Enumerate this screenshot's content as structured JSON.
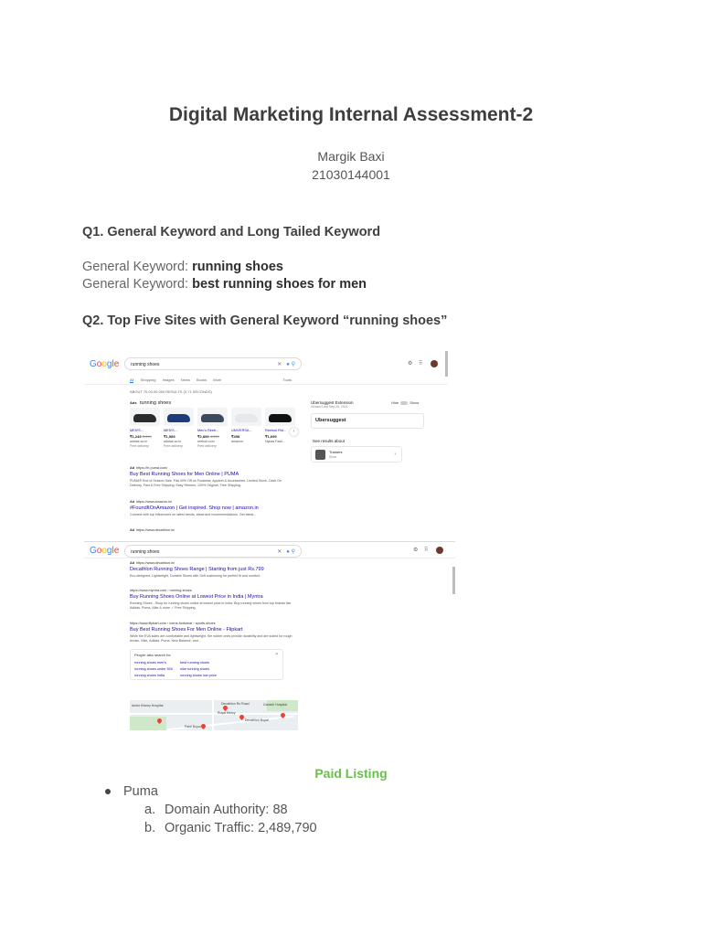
{
  "title": "Digital Marketing Internal Assessment-2",
  "author": {
    "name": "Margik Baxi",
    "id": "21030144001"
  },
  "q1": {
    "heading": "Q1. General Keyword and Long Tailed Keyword",
    "general_label": "General Keyword:",
    "general_value": "running shoes",
    "long_label": "General Keyword:",
    "long_value": "best running shoes for men"
  },
  "q2": {
    "heading": "Q2. Top Five Sites with General Keyword “running shoes”"
  },
  "screenshot1": {
    "logo": [
      "G",
      "o",
      "o",
      "g",
      "l",
      "e"
    ],
    "query": "running shoes",
    "tabs": [
      "All",
      "Shopping",
      "Images",
      "News",
      "Books",
      "More",
      "Tools"
    ],
    "results_count": "ABOUT 70,00,00,000 RESULTS (0.71 SECONDS)",
    "ads_label": "Ads",
    "ads_title": "running shoes",
    "products": [
      {
        "title": "MEN'S...",
        "price": "₹1,249",
        "old_price": "2,499",
        "seller": "adidas.co.in",
        "delivery": "Free delivery",
        "color": "#2b2b2b"
      },
      {
        "title": "MEN'S...",
        "price": "₹1,989",
        "old_price": "",
        "seller": "adidas.co.in",
        "delivery": "Free delivery",
        "color": "#1f3c7a"
      },
      {
        "title": "Men's Reeb...",
        "price": "₹2,899",
        "old_price": "4,999",
        "seller": "reebok.com",
        "delivery": "Free delivery",
        "color": "#3b4a5c"
      },
      {
        "title": "UNIVERSA...",
        "price": "₹498",
        "old_price": "",
        "seller": "amazon",
        "delivery": "",
        "color": "#e8e8e8"
      },
      {
        "title": "Reebok Rid...",
        "price": "₹1,699",
        "old_price": "",
        "seller": "Nykaa Fash...",
        "delivery": "",
        "color": "#111111"
      }
    ],
    "results": [
      {
        "ad": "Ad",
        "url": "https://in.puma.com/",
        "title": "Buy Best Running Shoes for Men Online | PUMA",
        "desc": "PUMA® End of Season Sale. Flat 40% Off on Footwear, Apparel & Accessories. Limited Stock. Cash On Delivery, Fast & Free Shipping, Easy Returns, 100% Original, Free Shipping."
      },
      {
        "ad": "Ad",
        "url": "https://www.amazon.in/",
        "title": "#FoundItOnAmazon | Get inspired. Shop now | amazon.in",
        "desc": "Connect with top influencers on latest trends, ideas and recommendations. Get latest..."
      },
      {
        "ad": "Ad",
        "url": "https://www.decathlon.in/",
        "title": "",
        "desc": ""
      }
    ],
    "side": {
      "title": "Ubersuggest Extension",
      "subtitle": "Viewed Last Sep 26, 2021",
      "hide": "Hide",
      "show": "Show",
      "box": "Ubersuggest",
      "see_results": "See results about",
      "card_name": "Trainers",
      "card_sub": "Shoe"
    }
  },
  "screenshot2": {
    "logo": [
      "G",
      "o",
      "o",
      "g",
      "l",
      "e"
    ],
    "query": "running shoes",
    "results": [
      {
        "ad": "Ad",
        "url": "https://www.decathlon.in/",
        "title": "Decathlon Running Shoes Range | Starting from just Rs.799",
        "desc": "Eco-designed, Lightweight, Durable Shoes with Soft cushioning for perfect fit and comfort."
      },
      {
        "ad": "",
        "url": "https://www.myntra.com › running-shoes",
        "title": "Buy Running Shoes Online at Lowest Price in India | Myntra",
        "desc": "Running Shoes - Shop for running shoes online at lowest price in India. Buy running shoes from top brands like Adidas, Puma, Nike & more ✓ Free Shipping."
      },
      {
        "ad": "",
        "url": "https://www.flipkart.com › mens-footwear › sports-shoes",
        "title": "Buy Best Running Shoes For Men Online - Flipkart",
        "desc": "While the EVA soles are comfortable and lightweight, the rubber ones provide durability and are suited for rough terrain. Nike, Adidas, Puma, New Balance, and..."
      }
    ],
    "people_also_search": {
      "heading": "People also search for",
      "items": [
        "running shoes men's",
        "best running shoes",
        "running shoes under 500",
        "nike running shoes",
        "running shoes india",
        "running shoes low price"
      ]
    },
    "map_labels": [
      "Ambe Kidney Hospital",
      "Royal Mercy",
      "Decathlon Bopal",
      "Decathlon Ro Road",
      "Paldi Bopal",
      "Ganesh Hospital"
    ]
  },
  "paid_listing": "Paid Listing",
  "sites": [
    {
      "name": "Puma",
      "stats": [
        {
          "marker": "a.",
          "label": "Domain Authority: 88"
        },
        {
          "marker": "b.",
          "label": "Organic Traffic: 2,489,790"
        }
      ]
    }
  ]
}
